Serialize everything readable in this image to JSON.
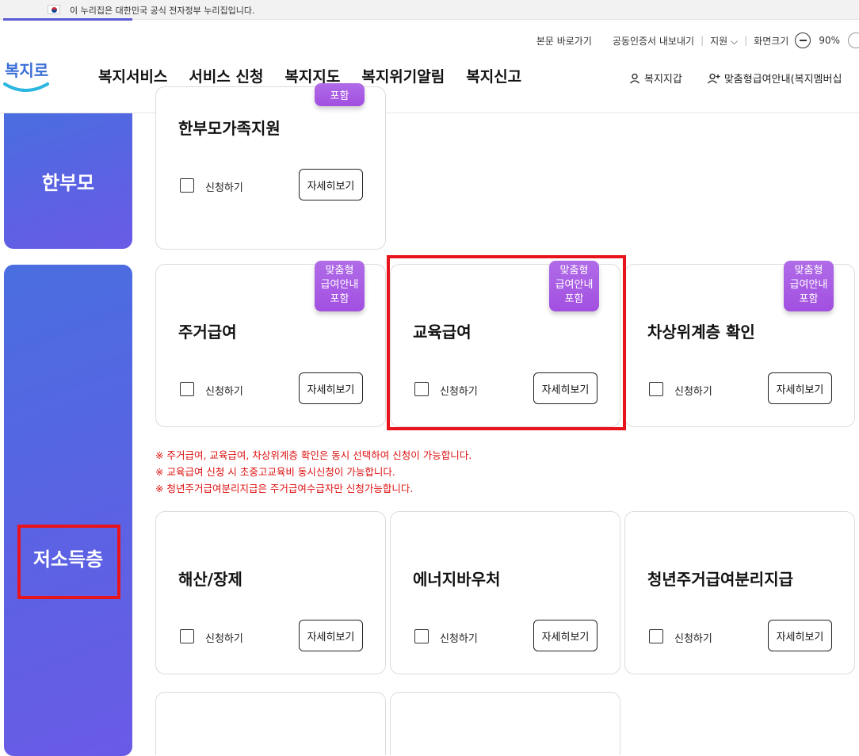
{
  "gov_banner": {
    "text": "이 누리집은 대한민국 공식 전자정부 누리집입니다."
  },
  "utility": {
    "skip": "본문 바로가기",
    "cert_export": "공동인증서 내보내기",
    "support": "지원 ⌵",
    "screen_size_label": "화면크기",
    "zoom": "90%"
  },
  "logo": {
    "text": "복지로"
  },
  "nav": [
    "복지서비스",
    "서비스 신청",
    "복지지도",
    "복지위기알림",
    "복지신고"
  ],
  "header_right": {
    "wallet": "복지지갑",
    "custom_info": "맞춤형급여안내(복지멤버십"
  },
  "categories": {
    "single_parent": "한부모",
    "low_income": "저소득층"
  },
  "common": {
    "apply": "신청하기",
    "detail": "자세히보기",
    "badge_line1": "맞춤형",
    "badge_line2": "급여안내",
    "badge_line3": "포함"
  },
  "cards": {
    "single_parent_support": "한부모가족지원",
    "housing": "주거급여",
    "education": "교육급여",
    "near_poverty": "차상위계층 확인",
    "childbirth_funeral": "해산/장제",
    "energy_voucher": "에너지바우처",
    "youth_housing": "청년주거급여분리지급"
  },
  "notes": [
    "※ 주거급여, 교육급여, 차상위계층 확인은 동시 선택하여 신청이 가능합니다.",
    "※ 교육급여 신청 시 초중고교육비 동시신청이 가능합니다.",
    "※ 청년주거급여분리지급은 주거급여수급자만 신청가능합니다."
  ],
  "colors": {
    "accent": "#5b62e3",
    "badge": "#a855e6",
    "highlight": "#e8141c",
    "note": "#d11111"
  }
}
